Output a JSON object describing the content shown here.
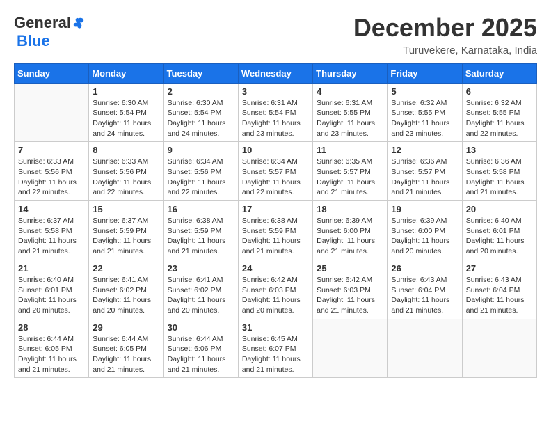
{
  "logo": {
    "general": "General",
    "blue": "Blue"
  },
  "header": {
    "month": "December 2025",
    "location": "Turuvekere, Karnataka, India"
  },
  "days": [
    "Sunday",
    "Monday",
    "Tuesday",
    "Wednesday",
    "Thursday",
    "Friday",
    "Saturday"
  ],
  "weeks": [
    [
      {
        "day": "",
        "content": ""
      },
      {
        "day": "1",
        "content": "Sunrise: 6:30 AM\nSunset: 5:54 PM\nDaylight: 11 hours\nand 24 minutes."
      },
      {
        "day": "2",
        "content": "Sunrise: 6:30 AM\nSunset: 5:54 PM\nDaylight: 11 hours\nand 24 minutes."
      },
      {
        "day": "3",
        "content": "Sunrise: 6:31 AM\nSunset: 5:54 PM\nDaylight: 11 hours\nand 23 minutes."
      },
      {
        "day": "4",
        "content": "Sunrise: 6:31 AM\nSunset: 5:55 PM\nDaylight: 11 hours\nand 23 minutes."
      },
      {
        "day": "5",
        "content": "Sunrise: 6:32 AM\nSunset: 5:55 PM\nDaylight: 11 hours\nand 23 minutes."
      },
      {
        "day": "6",
        "content": "Sunrise: 6:32 AM\nSunset: 5:55 PM\nDaylight: 11 hours\nand 22 minutes."
      }
    ],
    [
      {
        "day": "7",
        "content": "Sunrise: 6:33 AM\nSunset: 5:56 PM\nDaylight: 11 hours\nand 22 minutes."
      },
      {
        "day": "8",
        "content": "Sunrise: 6:33 AM\nSunset: 5:56 PM\nDaylight: 11 hours\nand 22 minutes."
      },
      {
        "day": "9",
        "content": "Sunrise: 6:34 AM\nSunset: 5:56 PM\nDaylight: 11 hours\nand 22 minutes."
      },
      {
        "day": "10",
        "content": "Sunrise: 6:34 AM\nSunset: 5:57 PM\nDaylight: 11 hours\nand 22 minutes."
      },
      {
        "day": "11",
        "content": "Sunrise: 6:35 AM\nSunset: 5:57 PM\nDaylight: 11 hours\nand 21 minutes."
      },
      {
        "day": "12",
        "content": "Sunrise: 6:36 AM\nSunset: 5:57 PM\nDaylight: 11 hours\nand 21 minutes."
      },
      {
        "day": "13",
        "content": "Sunrise: 6:36 AM\nSunset: 5:58 PM\nDaylight: 11 hours\nand 21 minutes."
      }
    ],
    [
      {
        "day": "14",
        "content": "Sunrise: 6:37 AM\nSunset: 5:58 PM\nDaylight: 11 hours\nand 21 minutes."
      },
      {
        "day": "15",
        "content": "Sunrise: 6:37 AM\nSunset: 5:59 PM\nDaylight: 11 hours\nand 21 minutes."
      },
      {
        "day": "16",
        "content": "Sunrise: 6:38 AM\nSunset: 5:59 PM\nDaylight: 11 hours\nand 21 minutes."
      },
      {
        "day": "17",
        "content": "Sunrise: 6:38 AM\nSunset: 5:59 PM\nDaylight: 11 hours\nand 21 minutes."
      },
      {
        "day": "18",
        "content": "Sunrise: 6:39 AM\nSunset: 6:00 PM\nDaylight: 11 hours\nand 21 minutes."
      },
      {
        "day": "19",
        "content": "Sunrise: 6:39 AM\nSunset: 6:00 PM\nDaylight: 11 hours\nand 20 minutes."
      },
      {
        "day": "20",
        "content": "Sunrise: 6:40 AM\nSunset: 6:01 PM\nDaylight: 11 hours\nand 20 minutes."
      }
    ],
    [
      {
        "day": "21",
        "content": "Sunrise: 6:40 AM\nSunset: 6:01 PM\nDaylight: 11 hours\nand 20 minutes."
      },
      {
        "day": "22",
        "content": "Sunrise: 6:41 AM\nSunset: 6:02 PM\nDaylight: 11 hours\nand 20 minutes."
      },
      {
        "day": "23",
        "content": "Sunrise: 6:41 AM\nSunset: 6:02 PM\nDaylight: 11 hours\nand 20 minutes."
      },
      {
        "day": "24",
        "content": "Sunrise: 6:42 AM\nSunset: 6:03 PM\nDaylight: 11 hours\nand 20 minutes."
      },
      {
        "day": "25",
        "content": "Sunrise: 6:42 AM\nSunset: 6:03 PM\nDaylight: 11 hours\nand 21 minutes."
      },
      {
        "day": "26",
        "content": "Sunrise: 6:43 AM\nSunset: 6:04 PM\nDaylight: 11 hours\nand 21 minutes."
      },
      {
        "day": "27",
        "content": "Sunrise: 6:43 AM\nSunset: 6:04 PM\nDaylight: 11 hours\nand 21 minutes."
      }
    ],
    [
      {
        "day": "28",
        "content": "Sunrise: 6:44 AM\nSunset: 6:05 PM\nDaylight: 11 hours\nand 21 minutes."
      },
      {
        "day": "29",
        "content": "Sunrise: 6:44 AM\nSunset: 6:05 PM\nDaylight: 11 hours\nand 21 minutes."
      },
      {
        "day": "30",
        "content": "Sunrise: 6:44 AM\nSunset: 6:06 PM\nDaylight: 11 hours\nand 21 minutes."
      },
      {
        "day": "31",
        "content": "Sunrise: 6:45 AM\nSunset: 6:07 PM\nDaylight: 11 hours\nand 21 minutes."
      },
      {
        "day": "",
        "content": ""
      },
      {
        "day": "",
        "content": ""
      },
      {
        "day": "",
        "content": ""
      }
    ]
  ]
}
